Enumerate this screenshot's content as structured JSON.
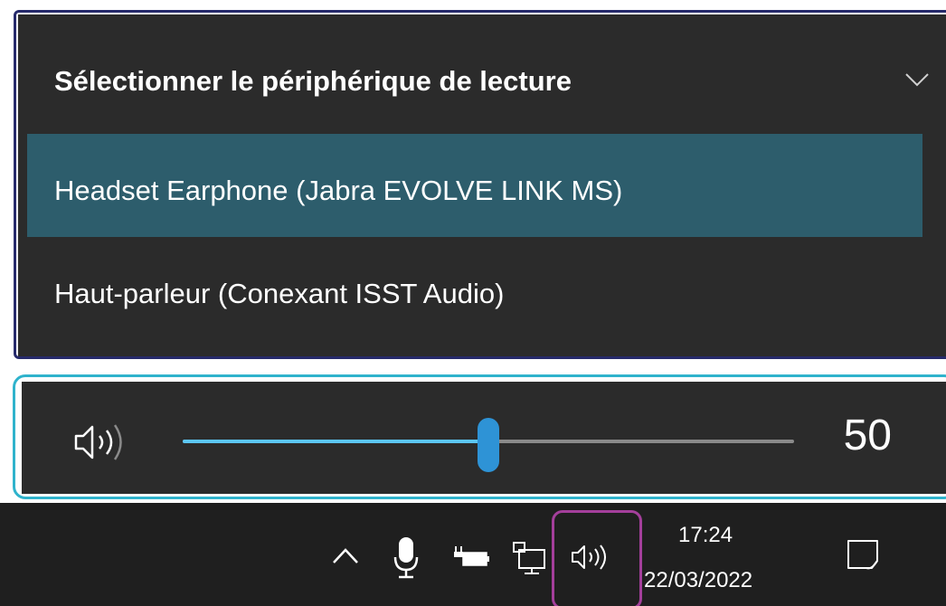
{
  "playback_selector": {
    "header_title": "Sélectionner le périphérique de lecture",
    "chevron_icon": "chevron-down-icon",
    "devices": [
      {
        "label": "Headset Earphone (Jabra EVOLVE LINK MS)",
        "selected": true
      },
      {
        "label": "Haut-parleur (Conexant ISST Audio)",
        "selected": false
      }
    ]
  },
  "volume": {
    "icon": "speaker-icon",
    "value_text": "50",
    "level_percent": 50
  },
  "taskbar": {
    "tray_icons": [
      "chevron-up-icon",
      "microphone-icon",
      "battery-icon",
      "network-icon",
      "speaker-icon"
    ],
    "clock": {
      "time": "17:24",
      "date": "22/03/2022"
    },
    "notification_icon": "notification-icon"
  },
  "colors": {
    "panel_background": "#2b2b2b",
    "selected_item": "#2d5d6c",
    "slider_fill": "#5cc6f5",
    "slider_thumb": "#2e93d6",
    "taskbar_background": "#1f1f1f",
    "frame_device": "#262a6b",
    "frame_volume": "#2fb3cc",
    "frame_speaker": "#a43f9b"
  }
}
